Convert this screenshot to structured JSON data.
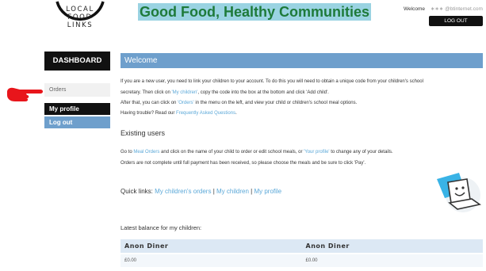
{
  "logo": {
    "line1": "LOCAL",
    "line2": "FOOD",
    "line3": "LINKS"
  },
  "site_title": "Good Food, Healthy Communities",
  "header": {
    "welcome_label": "Welcome",
    "masked_email": "∗∗∗ @btinternet.com",
    "logout_label": "LOG OUT"
  },
  "sidebar": {
    "dashboard_label": "DASHBOARD",
    "orders_label": "Orders",
    "profile_label": "My profile",
    "logout_label": "Log out"
  },
  "main": {
    "welcome_heading": "Welcome",
    "intro": {
      "line1": "If you are a new user, you need to link your children to your account. To do this you will need to obtain a unique code from your children's school",
      "line2_a": "secretary. Then click on ",
      "line2_link": "'My children'",
      "line2_b": ", copy the code into the box at the bottom and click 'Add child'.",
      "line3_a": "After that, you can click on ",
      "line3_link": "'Orders'",
      "line3_b": " in the menu on the left, and view your child or children's school meal options.",
      "line4_a": "Having trouble? Read our ",
      "line4_link": "Frequently Asked Questions",
      "line4_b": "."
    },
    "existing_heading": "Existing users",
    "existing": {
      "line1_a": "Go to ",
      "line1_link1": "Meal Orders",
      "line1_b": " and click on the name of your child to order or edit school meals, or ",
      "line1_link2": "'Your profile'",
      "line1_c": " to change any of your details.",
      "line2": "Orders are not complete until full payment has been received, so please choose the meals and be sure to click 'Pay'."
    },
    "quick_links": {
      "label": "Quick links: ",
      "link1": "My children's orders",
      "link2": "My children",
      "link3": "My profile",
      "separator": "|"
    },
    "balance_heading": "Latest balance for my children:",
    "balance_table": {
      "headers": [
        "Anon Diner",
        "Anon Diner"
      ],
      "values": [
        "£0.00",
        "£0.00"
      ]
    }
  },
  "colors": {
    "title_bg": "#9ad3e2",
    "title_text": "#1e7a3a",
    "accent_blue": "#6e9fcc",
    "link_blue": "#5ba8d8",
    "pointer_red": "#e8151b"
  },
  "icons": [
    "hand-pointer-icon",
    "laptop-smiley-icon"
  ]
}
